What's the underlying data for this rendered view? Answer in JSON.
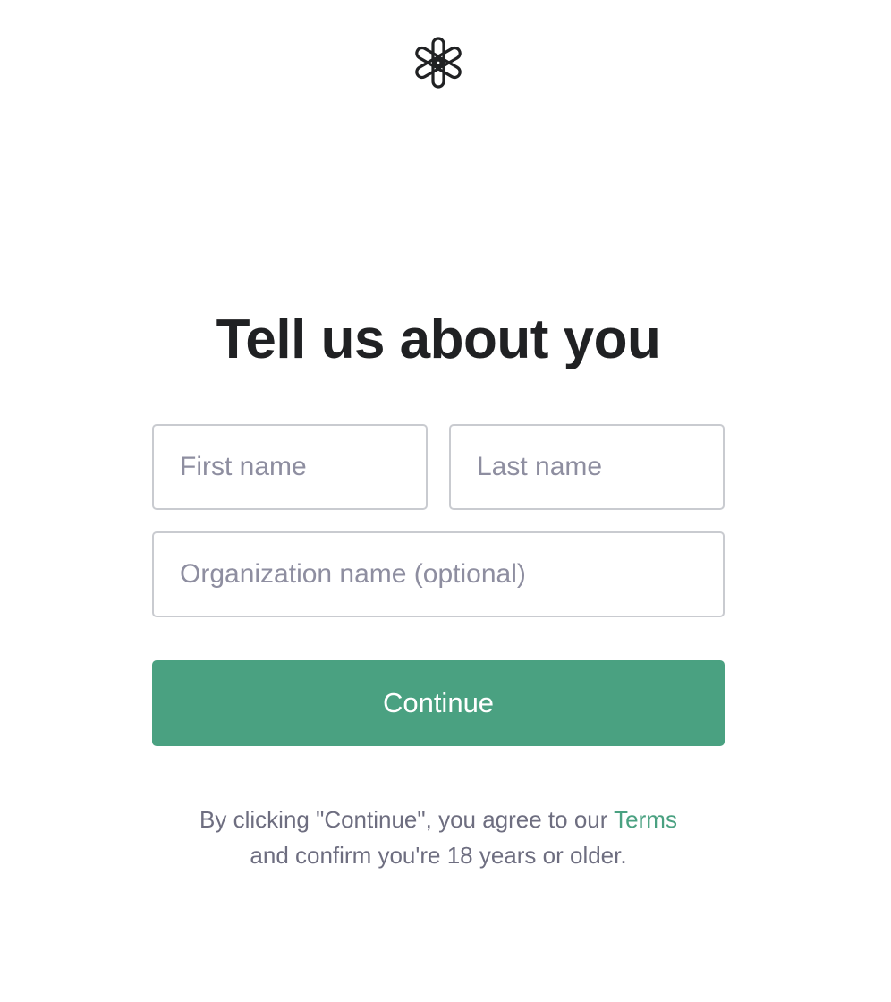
{
  "logo": {
    "icon": "openai-logo-icon"
  },
  "heading": "Tell us about you",
  "form": {
    "first_name_placeholder": "First name",
    "first_name_value": "",
    "last_name_placeholder": "Last name",
    "last_name_value": "",
    "org_placeholder": "Organization name (optional)",
    "org_value": "",
    "continue_label": "Continue"
  },
  "disclaimer": {
    "line1_prefix": "By clicking \"Continue\", you agree to our ",
    "terms_link": "Terms",
    "line2": "and confirm you're 18 years or older."
  },
  "colors": {
    "accent": "#4aa181",
    "text": "#202123",
    "muted": "#6e6e80",
    "border": "#c9cbd0",
    "placeholder": "#8e8ea0"
  }
}
